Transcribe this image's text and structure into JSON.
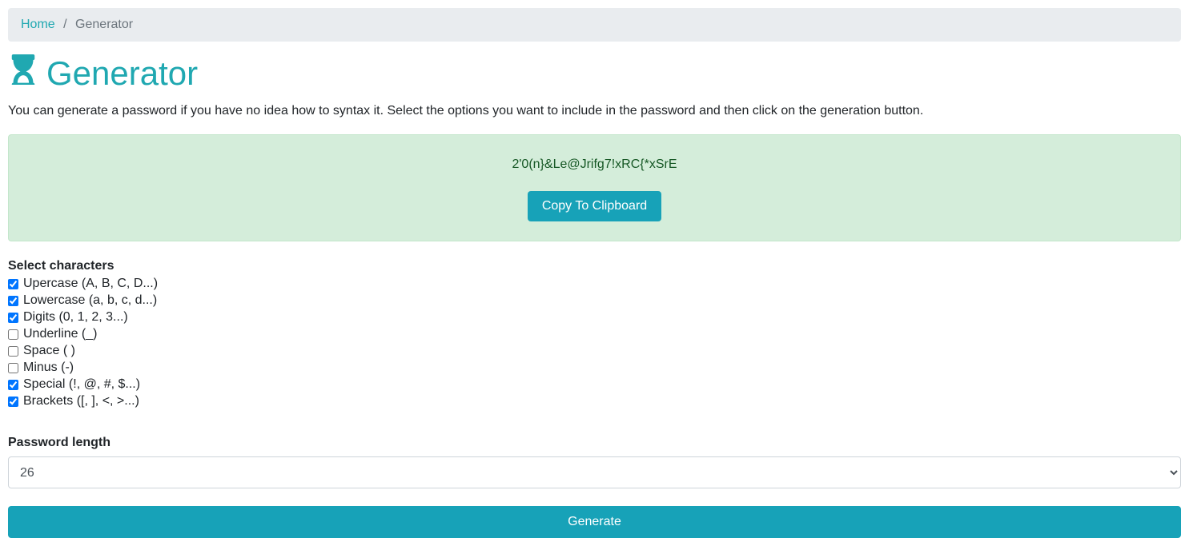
{
  "breadcrumb": {
    "home": "Home",
    "sep": "/",
    "current": "Generator"
  },
  "title": "Generator",
  "intro": "You can generate a password if you have no idea how to syntax it. Select the options you want to include in the password and then click on the generation button.",
  "result": {
    "text": "2'0(n}&Le@Jrifg7!xRC{*xSrE",
    "copy_label": "Copy To Clipboard"
  },
  "chars": {
    "label": "Select characters",
    "items": [
      {
        "label": "Upercase (A, B, C, D...)",
        "checked": true
      },
      {
        "label": "Lowercase (a, b, c, d...)",
        "checked": true
      },
      {
        "label": "Digits (0, 1, 2, 3...)",
        "checked": true
      },
      {
        "label": "Underline (_)",
        "checked": false
      },
      {
        "label": "Space ( )",
        "checked": false
      },
      {
        "label": "Minus (-)",
        "checked": false
      },
      {
        "label": "Special (!, @, #, $...)",
        "checked": true
      },
      {
        "label": "Brackets ([, ], <, >...)",
        "checked": true
      }
    ]
  },
  "length": {
    "label": "Password length",
    "value": "26"
  },
  "generate_label": "Generate"
}
